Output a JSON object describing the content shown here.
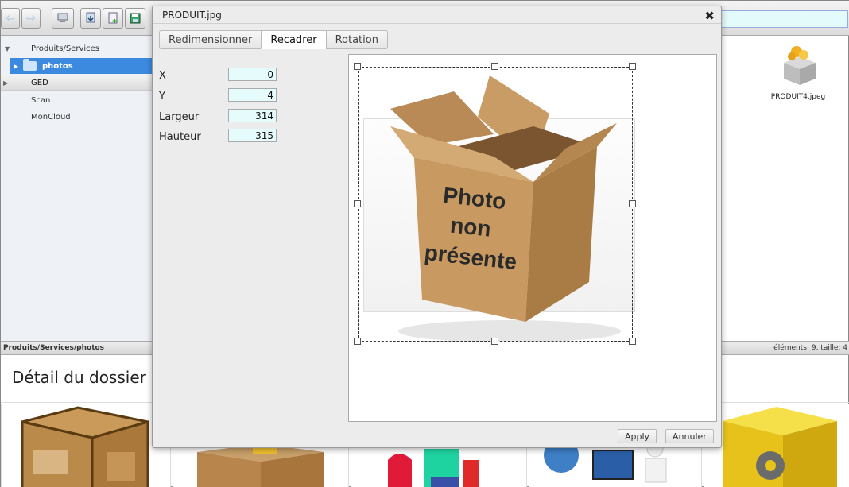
{
  "toolbar": {
    "buttons": [
      {
        "name": "back-button",
        "icon": "arrow-left-icon",
        "glyph": "⇦"
      },
      {
        "name": "forward-button",
        "icon": "arrow-right-icon",
        "glyph": "⇨"
      },
      {
        "name": "computer-button",
        "icon": "computer-icon"
      },
      {
        "name": "download-button",
        "icon": "download-icon"
      },
      {
        "name": "new-document-button",
        "icon": "new-document-icon"
      },
      {
        "name": "save-button",
        "icon": "floppy-disk-icon"
      }
    ]
  },
  "sidebar": {
    "items": [
      {
        "label": "Produits/Services"
      },
      {
        "label": "photos"
      },
      {
        "label": "GED"
      },
      {
        "label": "Scan"
      },
      {
        "label": "MonCloud"
      }
    ]
  },
  "files": [
    {
      "label": "PRODUIT4.jpeg",
      "icon": "package-icon"
    }
  ],
  "status": {
    "path": "Produits/Services/photos",
    "summary": "éléments: 9, taille: 4"
  },
  "detail": {
    "title": "Détail du dossier p"
  },
  "dialog": {
    "title": "PRODUIT.jpg",
    "close_icon": "close-icon",
    "tabs": [
      {
        "label": "Redimensionner",
        "active": false
      },
      {
        "label": "Recadrer",
        "active": true
      },
      {
        "label": "Rotation",
        "active": false
      }
    ],
    "fields": [
      {
        "label": "X",
        "value": "0"
      },
      {
        "label": "Y",
        "value": "4"
      },
      {
        "label": "Largeur",
        "value": "314"
      },
      {
        "label": "Hauteur",
        "value": "315"
      }
    ],
    "image_text": [
      "Photo",
      "non",
      "présente"
    ],
    "apply_label": "Apply",
    "cancel_label": "Annuler"
  }
}
